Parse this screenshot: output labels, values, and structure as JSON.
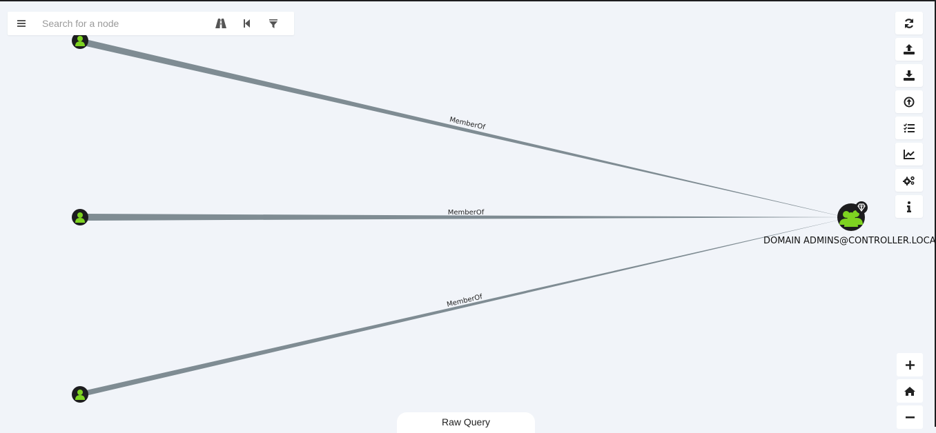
{
  "search": {
    "placeholder": "Search for a node"
  },
  "graph": {
    "edges": [
      {
        "label": "MemberOf"
      },
      {
        "label": "MemberOf"
      },
      {
        "label": "MemberOf"
      }
    ],
    "target_node": {
      "label": "DOMAIN ADMINS@CONTROLLER.LOCAL"
    }
  },
  "toolbar_right": [
    "refresh-icon",
    "upload-icon",
    "download-icon",
    "arrow-circle-up-icon",
    "tasks-icon",
    "chart-icon",
    "cogs-icon",
    "info-icon"
  ],
  "zoom": [
    "plus-icon",
    "home-icon",
    "minus-icon"
  ],
  "raw_query": {
    "label": "Raw Query"
  },
  "colors": {
    "node_bg": "#1d1d1f",
    "node_icon": "#7ed321",
    "edge": "#7f8c93",
    "background": "#f1f4f9"
  }
}
